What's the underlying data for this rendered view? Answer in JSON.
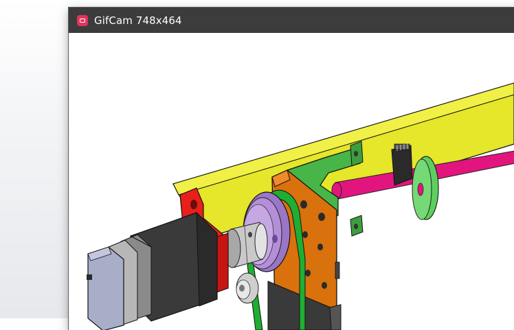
{
  "window": {
    "title": "GifCam 748x464",
    "icon": "camera-icon"
  },
  "viewport": {
    "content": "cad-assembly-3d-view"
  },
  "colors": {
    "beam": "#e6e62a",
    "rod": "#e2157f",
    "bracket": "#d9710c",
    "motor_mount": "#e8201c",
    "pulley": "#b48ed8",
    "belt": "#1fae32",
    "mount_green": "#47b548",
    "motor_dark": "#3a3a3a",
    "motor_cap": "#a8adc8"
  }
}
